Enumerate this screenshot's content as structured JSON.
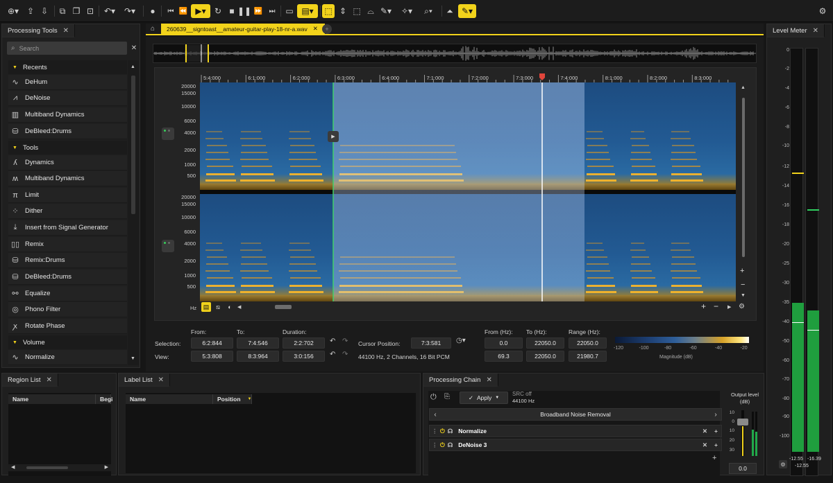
{
  "colors": {
    "accent": "#f2d31b",
    "panel": "#1f1f1f",
    "spec_blue": "#1e4f86",
    "spec_gold": "#f5a71c",
    "green": "#21a84a"
  },
  "toolbar": {
    "buttons": [
      "add-icon",
      "export-icon",
      "import-icon",
      "copy-icon",
      "paste-icon",
      "undo-icon",
      "redo-icon",
      "record-icon",
      "skip-start-icon",
      "rewind-icon",
      "play-icon",
      "loop-icon",
      "stop-icon",
      "pause-icon",
      "fast-forward-icon",
      "skip-end-icon",
      "view-toggle-icon",
      "display-icon",
      "time-select-icon",
      "freq-select-icon",
      "time-freq-select-icon",
      "lasso-icon",
      "brush-icon",
      "wand-icon",
      "zoom-icon",
      "gain-icon",
      "pencil-icon",
      "settings-icon"
    ]
  },
  "processing_tools": {
    "tab": "Processing Tools",
    "search_placeholder": "Search",
    "sections": [
      {
        "title": "Recents",
        "items": [
          {
            "icon": "dehum-icon",
            "label": "DeHum"
          },
          {
            "icon": "denoise-icon",
            "label": "DeNoise"
          },
          {
            "icon": "multiband-icon",
            "label": "Multiband Dynamics"
          },
          {
            "icon": "debleed-icon",
            "label": "DeBleed:Drums"
          }
        ]
      },
      {
        "title": "Tools",
        "items": [
          {
            "icon": "dynamics-icon",
            "label": "Dynamics"
          },
          {
            "icon": "multiband-icon",
            "label": "Multiband Dynamics"
          },
          {
            "icon": "limit-icon",
            "label": "Limit"
          },
          {
            "icon": "dither-icon",
            "label": "Dither"
          },
          {
            "icon": "signal-gen-icon",
            "label": "Insert from Signal Generator"
          },
          {
            "icon": "remix-icon",
            "label": "Remix"
          },
          {
            "icon": "remix-drums-icon",
            "label": "Remix:Drums"
          },
          {
            "icon": "debleed-icon",
            "label": "DeBleed:Drums"
          },
          {
            "icon": "equalize-icon",
            "label": "Equalize"
          },
          {
            "icon": "phono-icon",
            "label": "Phono Filter"
          },
          {
            "icon": "rotate-phase-icon",
            "label": "Rotate Phase"
          }
        ]
      },
      {
        "title": "Volume",
        "items": [
          {
            "icon": "normalize-icon",
            "label": "Normalize"
          }
        ]
      }
    ]
  },
  "file_tab": {
    "name": "260639__signtoast__amateur-guitar-play-18-nr-a.wav"
  },
  "ruler": [
    "5:4:000",
    "6:1:000",
    "6:2:000",
    "6:3:000",
    "6:4:000",
    "7:1:000",
    "7:2:000",
    "7:3:000",
    "7:4:000",
    "8:1:000",
    "8:2:000",
    "8:3:000"
  ],
  "freq_labels": [
    "20000",
    "15000",
    "10000",
    "6000",
    "4000",
    "2000",
    "1000",
    "500"
  ],
  "spec_toolbar": {
    "unit": "Hz"
  },
  "selection": {
    "headers": {
      "from": "From:",
      "to": "To:",
      "duration": "Duration:",
      "from_hz": "From (Hz):",
      "to_hz": "To (Hz):",
      "range_hz": "Range (Hz):"
    },
    "selection_label": "Selection:",
    "view_label": "View:",
    "selection": {
      "from": "6:2:844",
      "to": "7:4:546",
      "duration": "2:2:702",
      "from_hz": "0.0",
      "to_hz": "22050.0",
      "range_hz": "22050.0"
    },
    "view": {
      "from": "5:3:808",
      "to": "8:3:964",
      "duration": "3:0:156",
      "from_hz": "69.3",
      "to_hz": "22050.0",
      "range_hz": "21980.7"
    },
    "cursor_label": "Cursor Position:",
    "cursor_value": "7:3:581",
    "format": "44100 Hz, 2 Channels, 16 Bit PCM"
  },
  "magnitude": {
    "ticks": [
      "-120",
      "-100",
      "-80",
      "-60",
      "-40",
      "-20"
    ],
    "label": "Magnitude (dB)"
  },
  "level_meter": {
    "tab": "Level Meter",
    "scale": [
      "0",
      "-2",
      "-4",
      "-6",
      "-8",
      "-10",
      "-12",
      "-14",
      "-16",
      "-18",
      "-20",
      "-25",
      "-30",
      "-35",
      "-40",
      "-50",
      "-60",
      "-70",
      "-80",
      "-90",
      "-100"
    ],
    "peak_left": "-12.55",
    "peak_right": "-16.39",
    "readout": "-12.55",
    "fill": {
      "left_db": -35,
      "right_db": -37
    }
  },
  "region_list": {
    "tab": "Region List",
    "columns": [
      "Name",
      "Begi"
    ]
  },
  "label_list": {
    "tab": "Label List",
    "columns": [
      "Name",
      "Position"
    ]
  },
  "processing_chain": {
    "tab": "Processing Chain",
    "apply": "Apply",
    "src": "SRC off",
    "rate": "44100 Hz",
    "preset": "Broadband Noise Removal",
    "modules": [
      "Normalize",
      "DeNoise 3"
    ],
    "output_label": "Output level (dB)",
    "output_value": "0.0",
    "output_scale": [
      "10",
      "0",
      "10",
      "20",
      "30"
    ]
  }
}
